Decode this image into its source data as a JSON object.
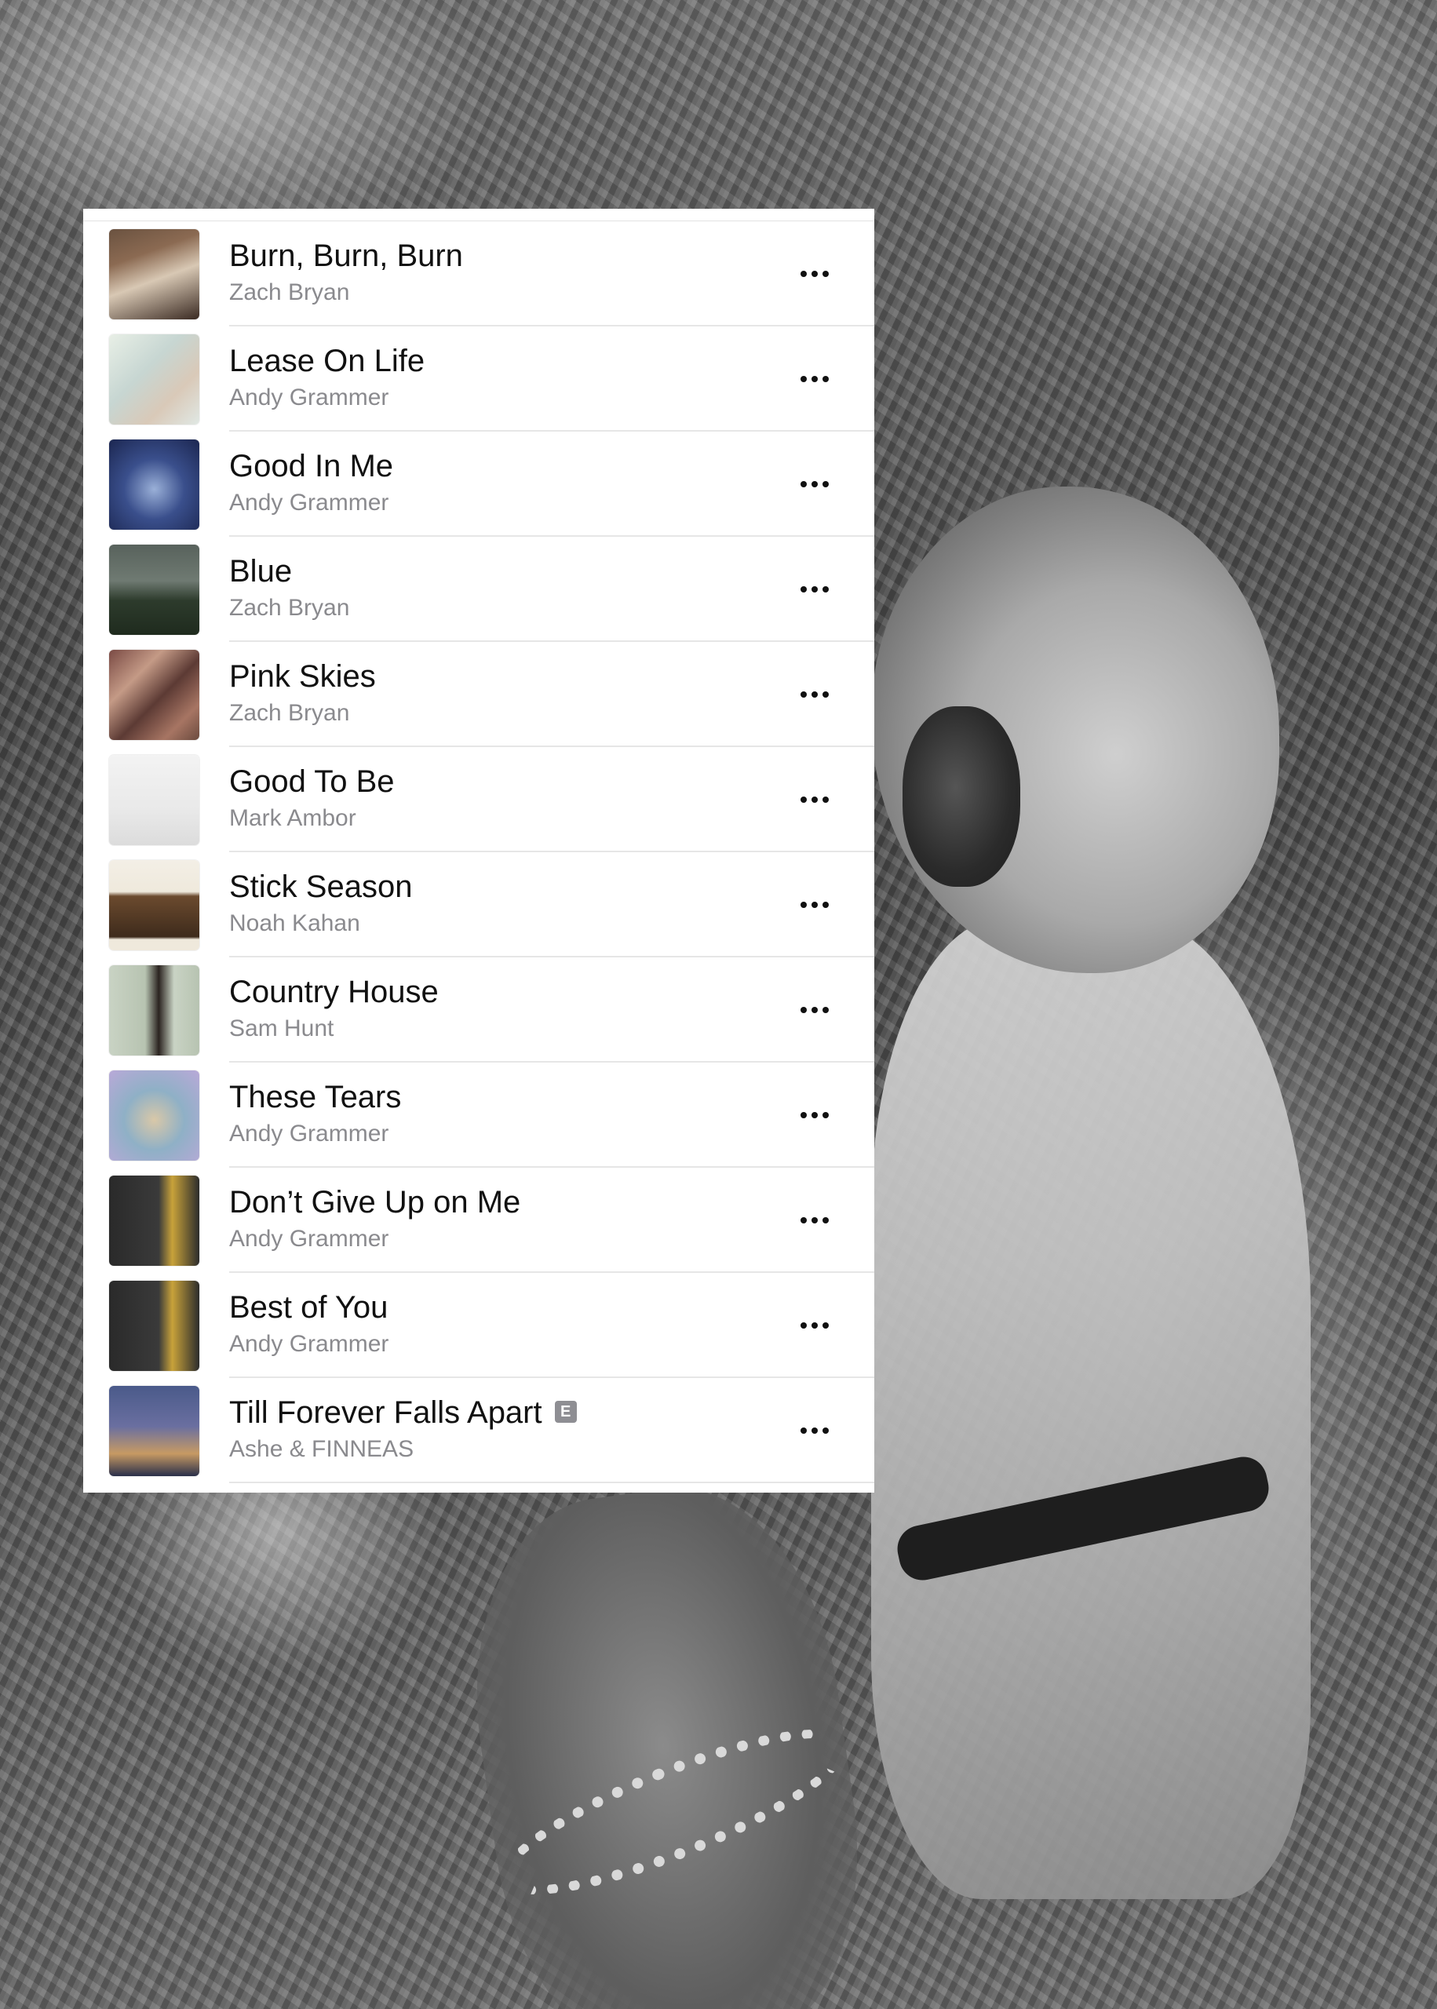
{
  "playlist": {
    "tracks": [
      {
        "title": "Burn, Burn, Burn",
        "artist": "Zach Bryan",
        "explicit": false,
        "art_icon": "album-art-burn-burn-burn"
      },
      {
        "title": "Lease On Life",
        "artist": "Andy Grammer",
        "explicit": false,
        "art_icon": "album-art-lease-on-life"
      },
      {
        "title": "Good In Me",
        "artist": "Andy Grammer",
        "explicit": false,
        "art_icon": "album-art-good-in-me"
      },
      {
        "title": "Blue",
        "artist": "Zach Bryan",
        "explicit": false,
        "art_icon": "album-art-blue"
      },
      {
        "title": "Pink Skies",
        "artist": "Zach Bryan",
        "explicit": false,
        "art_icon": "album-art-pink-skies"
      },
      {
        "title": "Good To Be",
        "artist": "Mark Ambor",
        "explicit": false,
        "art_icon": "album-art-good-to-be"
      },
      {
        "title": "Stick Season",
        "artist": "Noah Kahan",
        "explicit": false,
        "art_icon": "album-art-stick-season"
      },
      {
        "title": "Country House",
        "artist": "Sam Hunt",
        "explicit": false,
        "art_icon": "album-art-locked-up"
      },
      {
        "title": "These Tears",
        "artist": "Andy Grammer",
        "explicit": false,
        "art_icon": "album-art-these-tears"
      },
      {
        "title": "Don’t Give Up on Me",
        "artist": "Andy Grammer",
        "explicit": false,
        "art_icon": "album-art-naive"
      },
      {
        "title": "Best of You",
        "artist": "Andy Grammer",
        "explicit": false,
        "art_icon": "album-art-naive"
      },
      {
        "title": "Till Forever Falls Apart",
        "artist": "Ashe & FINNEAS",
        "explicit": true,
        "art_icon": "album-art-till-forever-falls-apart"
      }
    ],
    "explicit_badge": "E",
    "more_icon": "ellipsis-icon"
  },
  "colors": {
    "panel_background": "#ffffff",
    "title_text": "#111111",
    "artist_text": "#8a8a8e",
    "separator": "#e6e6e6",
    "explicit_badge": "#8e8e93"
  },
  "background": {
    "style": "grayscale photo"
  }
}
